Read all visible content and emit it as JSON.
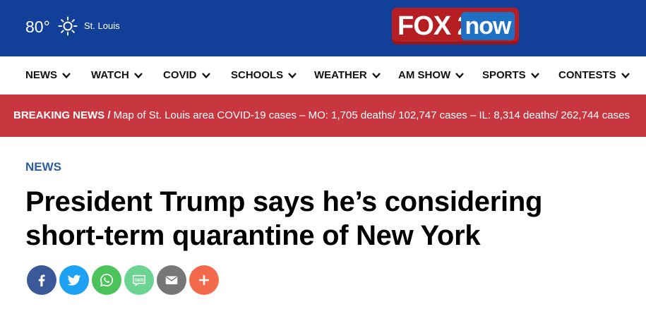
{
  "header": {
    "temperature": "80°",
    "weather_icon": "sun-icon",
    "city": "St. Louis",
    "logo_fox": "FOX 2",
    "logo_now": "now",
    "bg_color": "#124099",
    "logo_color": "#b51e22"
  },
  "nav": {
    "items": [
      {
        "label": "NEWS"
      },
      {
        "label": "WATCH"
      },
      {
        "label": "COVID"
      },
      {
        "label": "SCHOOLS"
      },
      {
        "label": "WEATHER"
      },
      {
        "label": "AM SHOW"
      },
      {
        "label": "SPORTS"
      },
      {
        "label": "CONTESTS"
      }
    ]
  },
  "breaking": {
    "tag": "BREAKING NEWS /",
    "text": " Map of St. Louis area COVID-19 cases – MO: 1,705 deaths/ 102,747 cases – IL: 8,314 deaths/ 262,744 cases",
    "bg_color": "#c8363f"
  },
  "article": {
    "category": "NEWS",
    "title": "President Trump says he’s considering short-term quarantine of New York"
  },
  "share": {
    "buttons": [
      {
        "name": "facebook",
        "icon": "facebook-icon",
        "color": "#3b5998"
      },
      {
        "name": "twitter",
        "icon": "twitter-icon",
        "color": "#1da1f2"
      },
      {
        "name": "whatsapp",
        "icon": "whatsapp-icon",
        "color": "#4bc35a"
      },
      {
        "name": "sms",
        "icon": "sms-icon",
        "color": "#6cd492",
        "label": "SMS"
      },
      {
        "name": "email",
        "icon": "email-icon",
        "color": "#777777"
      },
      {
        "name": "more",
        "icon": "plus-icon",
        "color": "#f26a4b"
      }
    ]
  }
}
